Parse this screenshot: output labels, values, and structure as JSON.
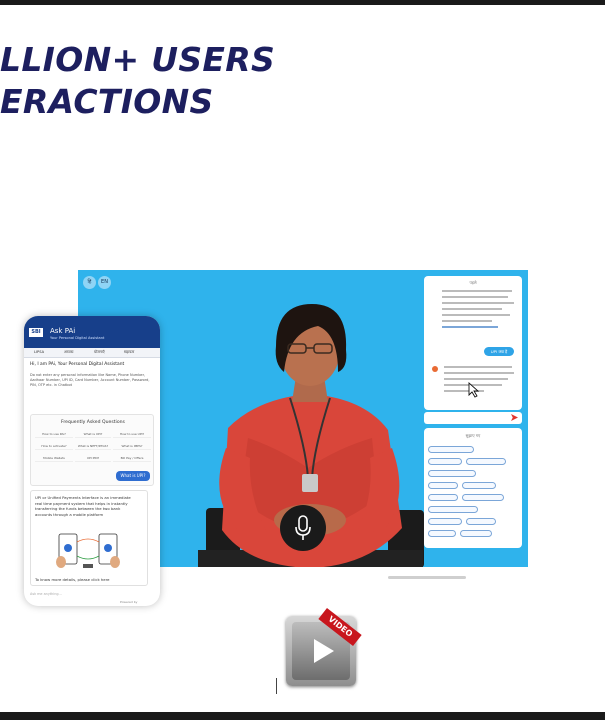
{
  "headline": {
    "line1": "LLION+ USERS",
    "line2": "ERACTIONS"
  },
  "video": {
    "lang_toggle": [
      "हि",
      "EN"
    ]
  },
  "chat": {
    "time_label": "पहले",
    "user_pill": "UPI क्या है",
    "header_bottom": "सुझाए गए"
  },
  "phone": {
    "logo": "SBI",
    "title": "Ask PAi",
    "subtitle": "Your Personal Digital Assistant",
    "tabs": [
      "LIPSA",
      "आपका",
      "योजनाएँ",
      "सहायता"
    ],
    "greeting": "Hi, I am PAi, Your Personal Digital Assistant",
    "warning": "Do not enter any personal information like Name, Phone Number, Aadhaar Number, UPI ID, Card Number, Account Number, Password, PIN, OTP etc. in Chatbot",
    "faq_title": "Frequently Asked Questions",
    "faq_items": [
      "How to use PAi?",
      "What is UPI?",
      "How to use UPI?",
      "How to activate?",
      "What is NEFT/RTGS?",
      "What is IMPS?",
      "Mobile Wallets",
      "UPI PIN?",
      "Bill Pay / Offers"
    ],
    "user_bubble": "What is UPI?",
    "answer": "UPI or Unified Payments Interface is an immediate real time payment system that helps in instantly transferring the funds between the two bank accounts through a mobile platform",
    "more": "To know more details, please click here",
    "input_placeholder": "Ask me anything...",
    "powered_by": "Powered by"
  },
  "play_badge": "VIDEO",
  "colors": {
    "brand_blue": "#173f8a",
    "panel_blue": "#2fb3ec",
    "headline": "#1d1f5f",
    "badge_red": "#c8161d"
  },
  "icons": [
    "microphone-icon",
    "play-icon",
    "send-icon"
  ]
}
